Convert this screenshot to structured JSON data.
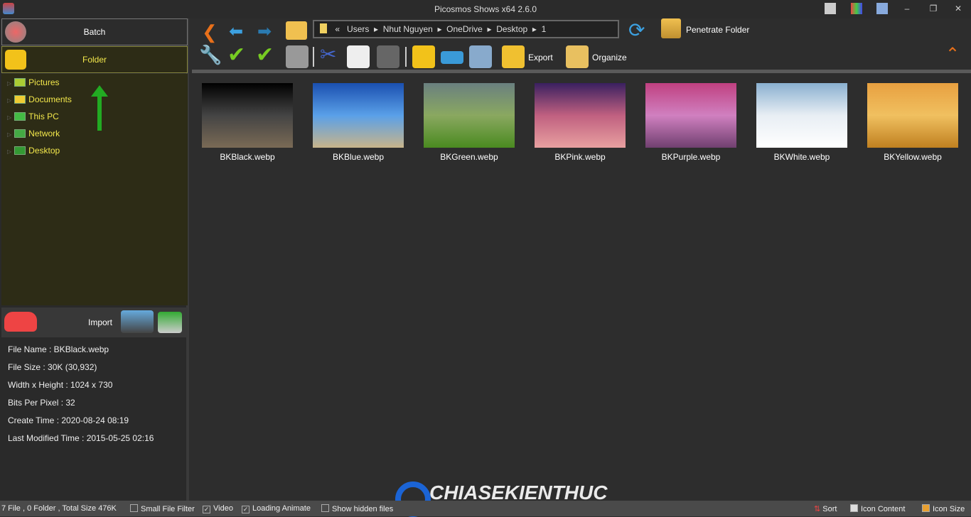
{
  "window": {
    "title": "Picosmos Shows x64 2.6.0"
  },
  "sidebar": {
    "batch": "Batch",
    "folder": "Folder",
    "tree": [
      "Pictures",
      "Documents",
      "This PC",
      "Network",
      "Desktop"
    ],
    "import": "Import"
  },
  "toolbar": {
    "breadcrumb": [
      "«",
      "Users",
      "Nhut Nguyen",
      "OneDrive",
      "Desktop",
      "1"
    ],
    "penetrate": "Penetrate Folder",
    "export": "Export",
    "organize": "Organize"
  },
  "files": [
    {
      "name": "BKBlack.webp",
      "colors": [
        "#000",
        "#444",
        "#7a6a55"
      ]
    },
    {
      "name": "BKBlue.webp",
      "colors": [
        "#1a4fb0",
        "#5aa0e8",
        "#c8b48a"
      ]
    },
    {
      "name": "BKGreen.webp",
      "colors": [
        "#6a8080",
        "#8aa860",
        "#4a8a20"
      ]
    },
    {
      "name": "BKPink.webp",
      "colors": [
        "#3a2060",
        "#c06080",
        "#e8a0a0"
      ]
    },
    {
      "name": "BKPurple.webp",
      "colors": [
        "#c04080",
        "#d080c0",
        "#704070"
      ]
    },
    {
      "name": "BKWhite.webp",
      "colors": [
        "#8ab0d0",
        "#e8eef4",
        "#ffffff"
      ]
    },
    {
      "name": "BKYellow.webp",
      "colors": [
        "#e8a040",
        "#f0c060",
        "#c08020"
      ]
    }
  ],
  "info": {
    "file_name": "File Name : BKBlack.webp",
    "file_size": "File Size : 30K (30,932)",
    "dims": "Width x Height : 1024 x 730",
    "bpp": "Bits Per Pixel : 32",
    "create": "Create Time : 2020-08-24 08:19",
    "modified": "Last Modified Time : 2015-05-25 02:16"
  },
  "status": {
    "summary": "7 File , 0 Folder , Total Size 476K",
    "small_filter": "Small File Filter",
    "small_filter_checked": false,
    "video": "Video",
    "video_checked": true,
    "loading": "Loading Animate",
    "loading_checked": true,
    "hidden": "Show hidden files",
    "hidden_checked": false,
    "sort": "Sort",
    "icon_content": "Icon Content",
    "icon_size": "Icon Size"
  },
  "watermark": "CHIASEKIENTHUC"
}
